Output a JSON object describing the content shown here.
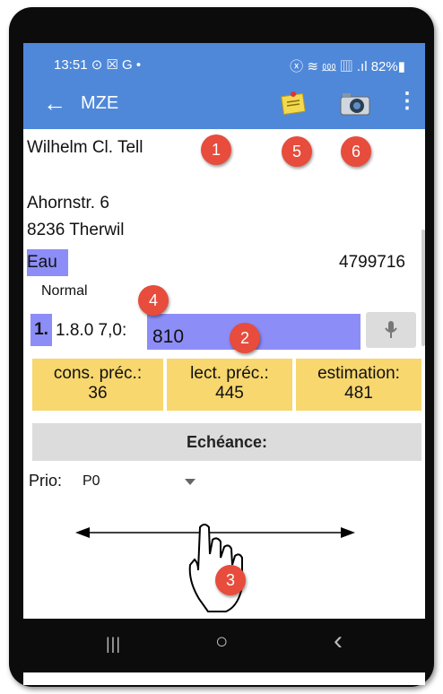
{
  "status_bar": {
    "time": "13:51 ⊙ ☒ G •",
    "indicators": "ⓧ ≋ ⅏ ▥ .ıl 82%▮"
  },
  "app_bar": {
    "back_icon": "arrow-left-icon",
    "title": "MZE",
    "memo_icon": "memo-note-icon",
    "camera_icon": "camera-icon",
    "more_icon": "more-vert-icon"
  },
  "customer": {
    "name": "Wilhelm Cl. Tell",
    "street": "Ahornstr. 6",
    "city": "8236 Therwil"
  },
  "meter": {
    "medium": "Eau",
    "number": "4799716",
    "reading_type": "Normal",
    "register_index": "1.",
    "register_code": "1.8.0 7,0:",
    "reading_value": "810"
  },
  "stats": [
    {
      "label": "cons. préc.:",
      "value": "36"
    },
    {
      "label": "lect. préc.:",
      "value": "445"
    },
    {
      "label": "estimation:",
      "value": "481"
    }
  ],
  "due_label": "Echéance:",
  "priority": {
    "label": "Prio:",
    "value": "P0"
  },
  "callouts": [
    "1",
    "2",
    "3",
    "4",
    "5",
    "6"
  ],
  "nav": {
    "recent": "|||",
    "home": "○",
    "back": "‹"
  },
  "colors": {
    "app_bar": "#4f88d9",
    "highlight": "#8d8df7",
    "stats_bg": "#f7d76e",
    "callout": "#e74c3c"
  }
}
